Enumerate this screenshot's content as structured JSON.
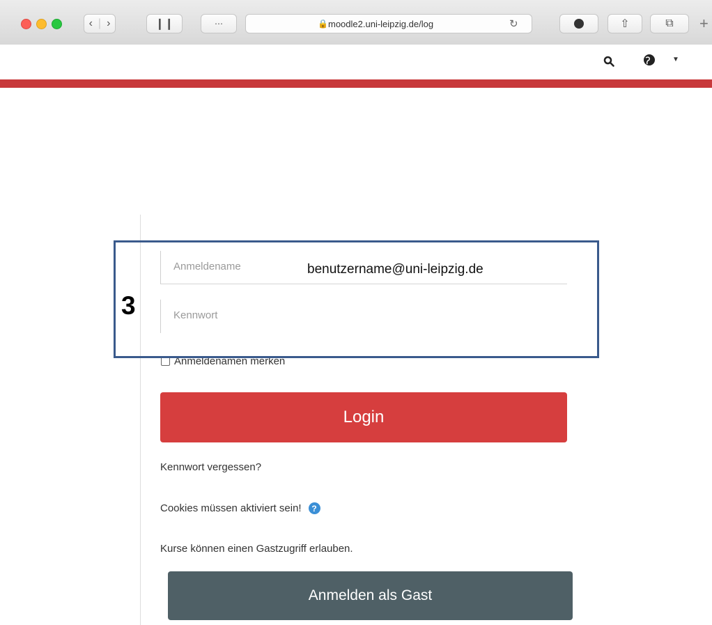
{
  "browser": {
    "address": "moodle2.uni-leipzig.de/log",
    "lock_icon": "lock-icon",
    "reload_icon": "reload-icon"
  },
  "header": {
    "search_icon": "search-icon",
    "language_icon": "globe-icon",
    "caret_icon": "caret-down-icon"
  },
  "login": {
    "username_placeholder": "Anmeldename",
    "username_value": "benutzername@uni-leipzig.de",
    "password_placeholder": "Kennwort",
    "remember_label": "Anmeldenamen merken",
    "login_button": "Login",
    "forgot_link": "Kennwort vergessen?",
    "cookies_text": "Cookies müssen aktiviert sein!",
    "guest_text": "Kurse können einen Gastzugriff erlauben.",
    "guest_button": "Anmelden als Gast"
  },
  "annotation": {
    "step_number": "3"
  },
  "colors": {
    "accent_red": "#d63e3e",
    "header_red": "#c8393b",
    "guest_button": "#4f6066",
    "annotation_border": "#3a5a8c"
  }
}
